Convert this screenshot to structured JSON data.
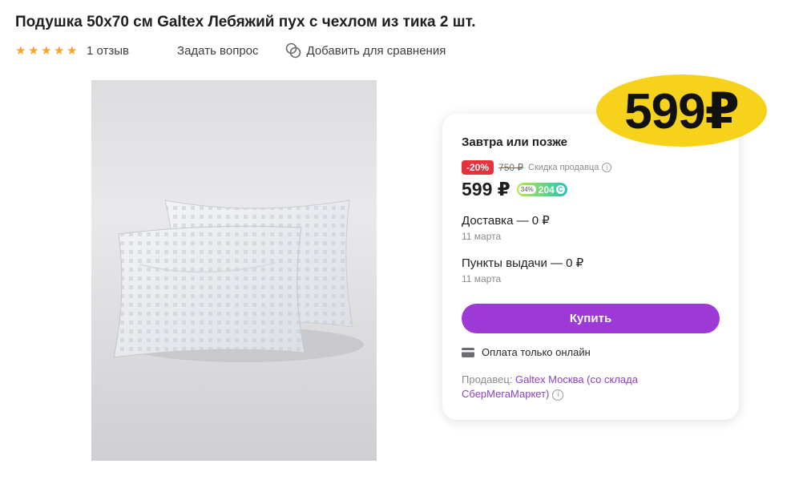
{
  "product": {
    "title": "Подушка 50x70 см Galtex Лебяжий пух с чехлом из тика 2 шт.",
    "rating": 5,
    "rating_max": 5,
    "reviews_label": "1 отзыв",
    "ask_question_label": "Задать вопрос",
    "compare_label": "Добавить для сравнения"
  },
  "sticker": {
    "price": "599₽"
  },
  "offer": {
    "delivery_title": "Завтра или позже",
    "discount_badge": "-20%",
    "old_price": "750 ₽",
    "seller_discount_label": "Скидка продавца",
    "info_icon": "i",
    "price": "599 ₽",
    "bonus_percent": "34%",
    "bonus_value": "204",
    "bonus_coin_icon": "С",
    "delivery_option": {
      "title": "Доставка — 0 ₽",
      "date": "11 марта"
    },
    "pickup_option": {
      "title": "Пункты выдачи — 0 ₽",
      "date": "11 марта"
    },
    "buy_label": "Купить",
    "payment_note": "Оплата только онлайн",
    "seller_prefix": "Продавец: ",
    "seller_name": "Galtex Москва (со склада СберМегаМаркет)"
  },
  "colors": {
    "accent": "#9d3ad6",
    "star": "#f5a52a",
    "discount": "#e8313d",
    "sticker": "#f6d21a",
    "bonus_start": "#b9e84a",
    "bonus_end": "#23c4b8"
  },
  "icons": {
    "star": "star-icon",
    "compare": "compare-icon",
    "info": "info-icon",
    "card": "credit-card-icon",
    "bonus": "bonus-coin-icon"
  }
}
